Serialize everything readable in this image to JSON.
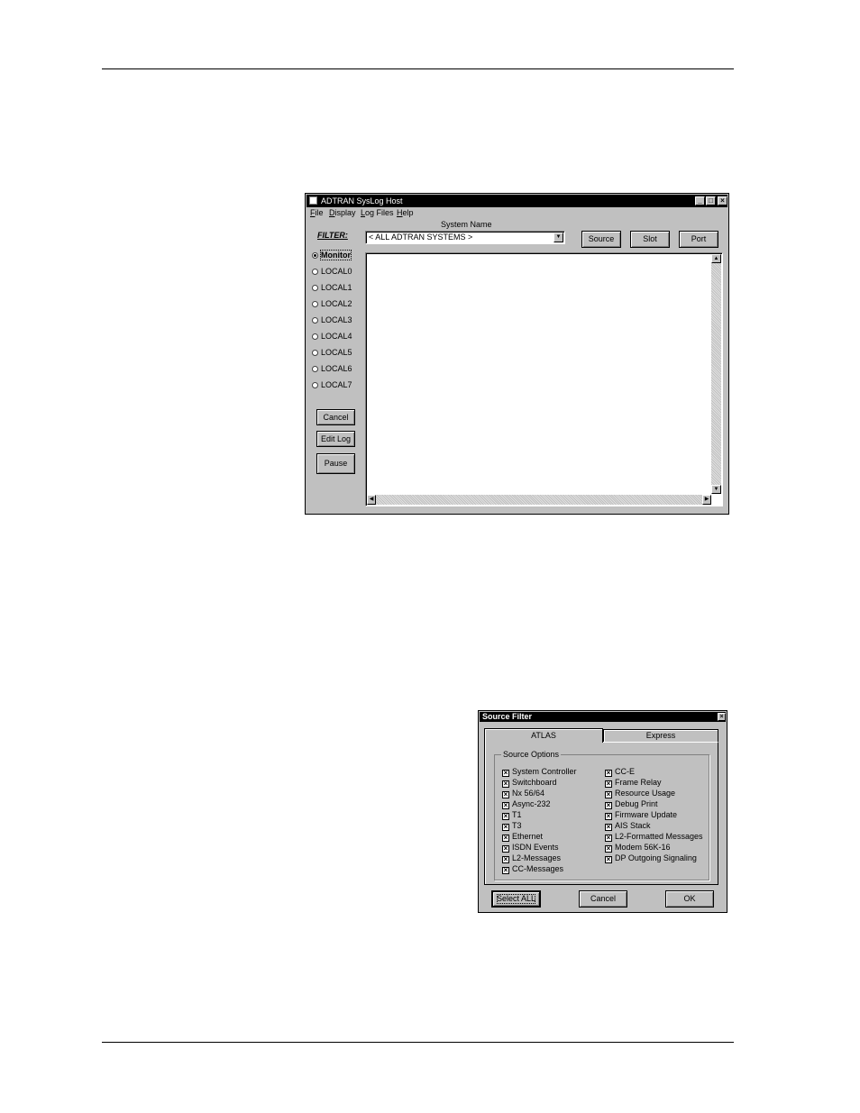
{
  "syslog_window": {
    "title": "ADTRAN SysLog Host",
    "menu": [
      "File",
      "Display",
      "Log Files",
      "Help"
    ],
    "filter_label": "FILTER:",
    "radios": [
      {
        "label": "Monitor",
        "selected": true
      },
      {
        "label": "LOCAL0",
        "selected": false
      },
      {
        "label": "LOCAL1",
        "selected": false
      },
      {
        "label": "LOCAL2",
        "selected": false
      },
      {
        "label": "LOCAL3",
        "selected": false
      },
      {
        "label": "LOCAL4",
        "selected": false
      },
      {
        "label": "LOCAL5",
        "selected": false
      },
      {
        "label": "LOCAL6",
        "selected": false
      },
      {
        "label": "LOCAL7",
        "selected": false
      }
    ],
    "system_name_label": "System Name",
    "system_name_value": "< ALL ADTRAN SYSTEMS >",
    "buttons": {
      "source": "Source",
      "slot": "Slot",
      "port": "Port",
      "cancel": "Cancel",
      "edit_log": "Edit Log",
      "pause": "Pause"
    }
  },
  "source_filter": {
    "title": "Source Filter",
    "tabs": [
      "ATLAS",
      "Express"
    ],
    "group_label": "Source Options",
    "left_options": [
      "System Controller",
      "Switchboard",
      "Nx 56/64",
      "Async-232",
      "T1",
      "T3",
      "Ethernet",
      "ISDN Events",
      "L2-Messages",
      "CC-Messages"
    ],
    "right_options": [
      "CC-E",
      "Frame Relay",
      "Resource Usage",
      "Debug Print",
      "Firmware Update",
      "AIS Stack",
      "L2-Formatted Messages",
      "Modem 56K-16",
      "DP Outgoing Signaling"
    ],
    "buttons": {
      "select_all": "Select ALL",
      "cancel": "Cancel",
      "ok": "OK"
    }
  },
  "icons": {
    "close": "close-icon",
    "minimize": "minimize-icon",
    "maximize": "maximize-icon",
    "dropdown": "chevron-down-icon"
  }
}
